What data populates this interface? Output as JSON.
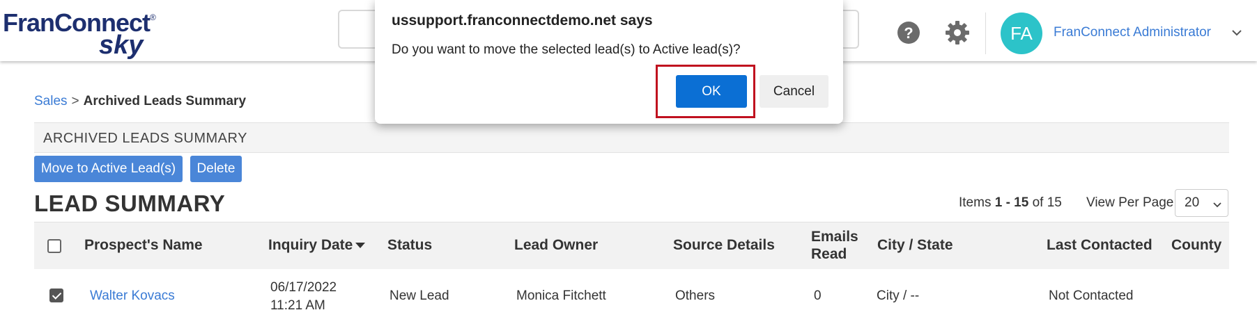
{
  "header": {
    "logo_top": "FranConnect",
    "logo_reg": "®",
    "logo_sky": "sky",
    "avatar_initials": "FA",
    "user_name": "FranConnect Administrator",
    "icons": [
      "help-icon",
      "gear-icon",
      "chevron-down-icon"
    ]
  },
  "breadcrumb": {
    "root": "Sales",
    "separator": ">",
    "current": "Archived Leads Summary"
  },
  "section": {
    "title": "ARCHIVED LEADS SUMMARY",
    "move_button": "Move to Active Lead(s)",
    "delete_button": "Delete"
  },
  "summary": {
    "heading": "LEAD SUMMARY",
    "items_prefix": "Items",
    "items_range": "1 - 15",
    "items_of": "of 15",
    "view_per_page_label": "View Per Page",
    "view_per_page_value": "20"
  },
  "table": {
    "columns": [
      "Prospect's Name",
      "Inquiry Date",
      "Status",
      "Lead Owner",
      "Source Details",
      "Emails",
      "Read",
      "City / State",
      "Last Contacted",
      "County"
    ],
    "rows": [
      {
        "checked": true,
        "name": "Walter Kovacs",
        "date": "06/17/2022",
        "time": "11:21 AM",
        "status": "New Lead",
        "owner": "Monica Fitchett",
        "source": "Others",
        "emails_read": "0",
        "city_state": "City / --",
        "last_contacted": "Not Contacted"
      }
    ]
  },
  "dialog": {
    "title": "ussupport.franconnectdemo.net says",
    "message": "Do you want to move the selected lead(s) to Active lead(s)?",
    "ok_label": "OK",
    "cancel_label": "Cancel",
    "highlight_color": "#c0111f"
  },
  "colors": {
    "brand_navy": "#1d2f6f",
    "link_blue": "#3a7bd5",
    "button_blue": "#4a86d8",
    "ok_blue": "#0b6fd4",
    "avatar_teal": "#2cc3c9"
  }
}
